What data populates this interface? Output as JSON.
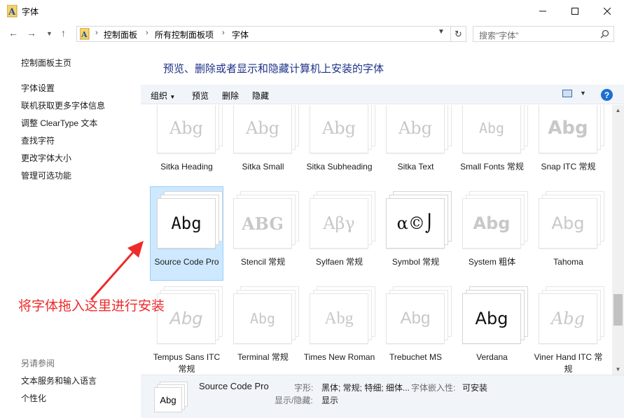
{
  "window": {
    "title": "字体"
  },
  "address": {
    "crumbs": [
      "控制面板",
      "所有控制面板项",
      "字体"
    ],
    "search_placeholder": "搜索\"字体\""
  },
  "left_pane": {
    "home": "控制面板主页",
    "links": [
      "字体设置",
      "联机获取更多字体信息",
      "调整 ClearType 文本",
      "查找字符",
      "更改字体大小",
      "管理可选功能"
    ],
    "see_also_title": "另请参阅",
    "see_also": [
      "文本服务和输入语言",
      "个性化"
    ]
  },
  "main": {
    "heading": "预览、删除或者显示和隐藏计算机上安装的字体",
    "toolbar": {
      "organize": "组织",
      "preview": "预览",
      "delete": "删除",
      "hide": "隐藏",
      "help": "?"
    }
  },
  "fonts": [
    {
      "label": "Sitka Heading",
      "sample": "Abg",
      "dim": true
    },
    {
      "label": "Sitka Small",
      "sample": "Abg",
      "dim": true
    },
    {
      "label": "Sitka Subheading",
      "sample": "Abg",
      "dim": true
    },
    {
      "label": "Sitka Text",
      "sample": "Abg",
      "dim": true
    },
    {
      "label": "Small Fonts 常规",
      "sample": "Abg",
      "dim": true
    },
    {
      "label": "Snap ITC 常规",
      "sample": "Abg",
      "dim": true
    },
    {
      "label": "Source Code Pro",
      "sample": "Abg",
      "dim": false,
      "selected": true
    },
    {
      "label": "Stencil 常规",
      "sample": "ABG",
      "dim": true
    },
    {
      "label": "Sylfaen 常规",
      "sample": "Aβγ",
      "dim": true
    },
    {
      "label": "Symbol 常规",
      "sample": "α©⌡",
      "dim": false
    },
    {
      "label": "System 粗体",
      "sample": "Abg",
      "dim": true
    },
    {
      "label": "Tahoma",
      "sample": "Abg",
      "dim": true
    },
    {
      "label": "Tempus Sans ITC 常规",
      "sample": "Abg",
      "dim": true
    },
    {
      "label": "Terminal 常规",
      "sample": "Abg",
      "dim": true
    },
    {
      "label": "Times New Roman",
      "sample": "Abg",
      "dim": true
    },
    {
      "label": "Trebuchet MS",
      "sample": "Abg",
      "dim": true
    },
    {
      "label": "Verdana",
      "sample": "Abg",
      "dim": false
    },
    {
      "label": "Viner Hand ITC 常规",
      "sample": "Abg",
      "dim": true
    }
  ],
  "annotation": {
    "text": "将字体拖入这里进行安装",
    "color": "#ee2b2b"
  },
  "details": {
    "thumb_sample": "Abg",
    "name": "Source Code Pro",
    "style_label": "字形:",
    "style_value": "黑体; 常规; 特细; 细体...",
    "embed_label": "字体嵌入性:",
    "embed_value": "可安装",
    "show_label": "显示/隐藏:",
    "show_value": "显示"
  }
}
